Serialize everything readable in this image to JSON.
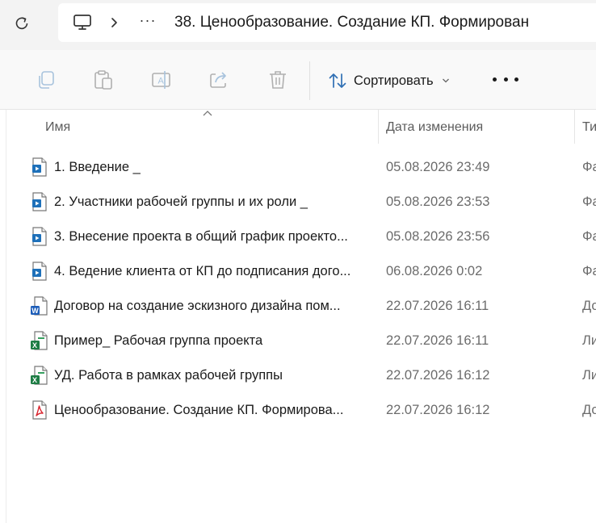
{
  "address": {
    "more_label": "···",
    "current_folder": "38. Ценообразование. Создание КП. Формирован"
  },
  "toolbar": {
    "sort_label": "Сортировать"
  },
  "columns": {
    "name": "Имя",
    "date": "Дата изменения",
    "type": "Ти"
  },
  "files": [
    {
      "name": "1. Введение _",
      "date": "05.08.2026 23:49",
      "type": "Фа",
      "icon": "video-file-icon"
    },
    {
      "name": "2. Участники рабочей группы и их роли _",
      "date": "05.08.2026 23:53",
      "type": "Фа",
      "icon": "video-file-icon"
    },
    {
      "name": "3. Внесение проекта в общий график проекто...",
      "date": "05.08.2026 23:56",
      "type": "Фа",
      "icon": "video-file-icon"
    },
    {
      "name": "4. Ведение клиента от КП до подписания дого...",
      "date": "06.08.2026 0:02",
      "type": "Фа",
      "icon": "video-file-icon"
    },
    {
      "name": "Договор на создание эскизного дизайна пом...",
      "date": "22.07.2026 16:11",
      "type": "До",
      "icon": "word-file-icon"
    },
    {
      "name": "Пример_ Рабочая группа проекта",
      "date": "22.07.2026 16:11",
      "type": "Ли",
      "icon": "excel-file-icon"
    },
    {
      "name": "УД. Работа в рамках рабочей группы",
      "date": "22.07.2026 16:12",
      "type": "Ли",
      "icon": "excel-file-icon"
    },
    {
      "name": "Ценообразование. Создание КП. Формирова...",
      "date": "22.07.2026 16:12",
      "type": "До",
      "icon": "pdf-file-icon"
    }
  ]
}
